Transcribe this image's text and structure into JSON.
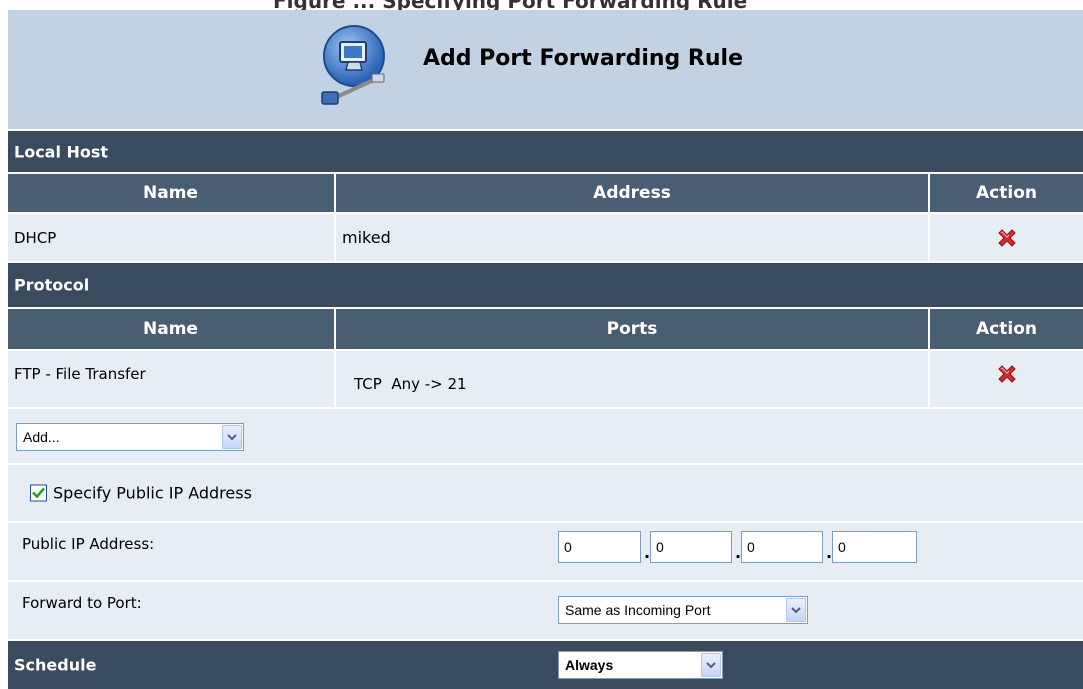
{
  "page": {
    "top_partial_text": "Figure ... Specifying Port Forwarding Rule",
    "title": "Add Port Forwarding Rule"
  },
  "local_host": {
    "section_label": "Local Host",
    "columns": [
      "Name",
      "Address",
      "Action"
    ],
    "row": {
      "name": "DHCP",
      "address": "miked",
      "action_icon": "delete-x-icon"
    }
  },
  "protocol": {
    "section_label": "Protocol",
    "columns": [
      "Name",
      "Ports",
      "Action"
    ],
    "row": {
      "name": "FTP - File Transfer",
      "ports": "TCP  Any -> 21",
      "action_icon": "delete-x-icon"
    },
    "add_select": {
      "value": "Add..."
    }
  },
  "public_ip": {
    "checkbox_label": "Specify Public IP Address",
    "checked": true,
    "field_label": "Public IP Address:",
    "octets": [
      "0",
      "0",
      "0",
      "0"
    ]
  },
  "forward": {
    "label": "Forward to Port:",
    "value": "Same as Incoming Port"
  },
  "schedule": {
    "label": "Schedule",
    "value": "Always"
  },
  "colors": {
    "header_bg": "#c3d2e2",
    "section_bg": "#394b5e",
    "column_header_bg": "#4a5e73",
    "row_bg": "#e7edf5",
    "delete_icon": "#d9272e"
  }
}
